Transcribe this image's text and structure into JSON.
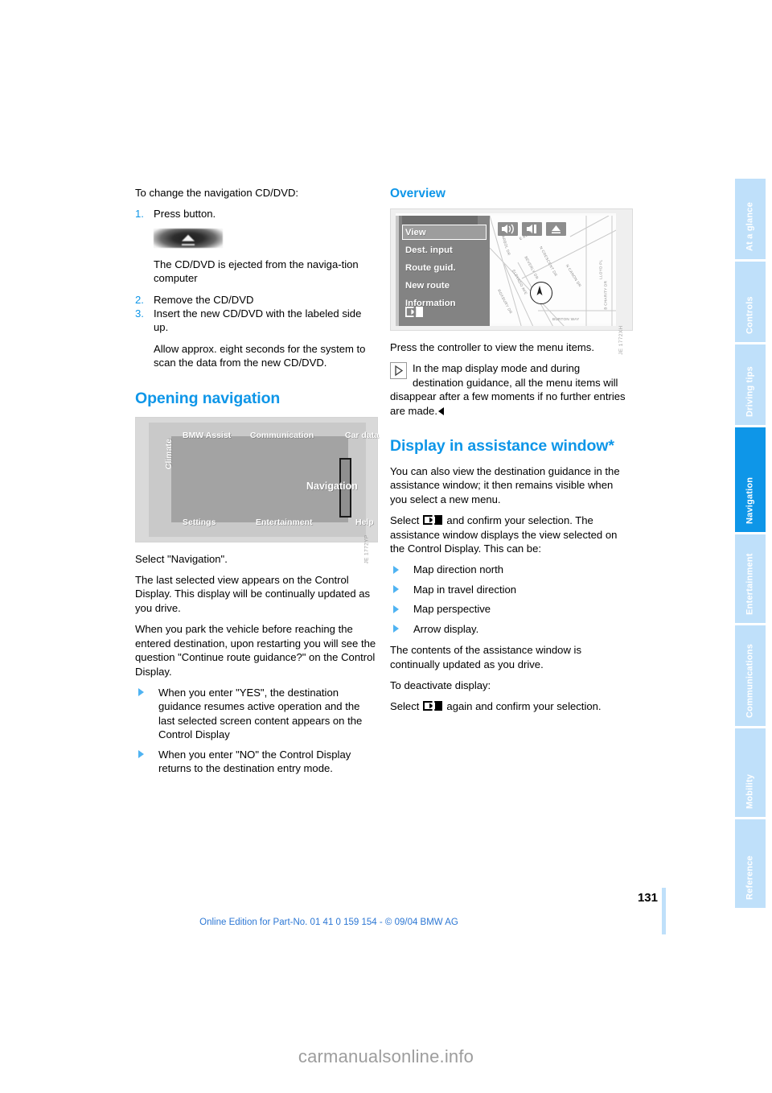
{
  "document": {
    "page_number": "131",
    "footer_text": "Online Edition for Part-No. 01 41 0 159 154 - © 09/04 BMW AG",
    "watermark": "carmanualsonline.info"
  },
  "left_column": {
    "intro": "To change the navigation CD/DVD:",
    "steps": [
      {
        "num": "1.",
        "text": "Press button."
      },
      {
        "num": "2.",
        "text": "Remove the CD/DVD"
      },
      {
        "num": "3.",
        "text": "Insert the new CD/DVD with the labeled side up."
      }
    ],
    "after_step1": "The CD/DVD is ejected from the naviga-tion computer",
    "after_step3": "Allow approx. eight seconds for the system to scan the data from the new CD/DVD.",
    "heading_opening_navigation": "Opening navigation",
    "select_navigation": "Select \"Navigation\".",
    "para_last_view": "The last selected view appears on the Control Display. This display will be continually updated as you drive.",
    "para_park": "When you park the vehicle before reaching the entered destination, upon restarting you will see the question \"Continue route guidance?\" on the Control Display.",
    "bullets": [
      "When you enter \"YES\", the destination guidance resumes active operation and the last selected screen content appears on the Control Display",
      "When you enter \"NO\" the Control Display returns to the destination entry mode."
    ]
  },
  "idrive_figure": {
    "name": "iDrive main menu screen",
    "labels": {
      "top_left": "BMW Assist",
      "top_center": "Communication",
      "top_right": "Car data",
      "left_side": "Climate",
      "center_right": "Navigation",
      "bottom_left": "Settings",
      "bottom_center": "Entertainment",
      "bottom_right": "Help"
    },
    "credit": "JE 1772YP"
  },
  "right_column": {
    "heading_overview": "Overview",
    "press_controller": "Press the controller to view the menu items.",
    "note": "In the map display mode and during destination guidance, all the menu items will disappear after a few moments if no further entries are made.",
    "heading_assistance": "Display in assistance window*",
    "para_assistance": "You can also view the destination guidance in the assistance window; it then remains visible when you select a new menu.",
    "select_prefix": "Select",
    "select_suffix": "and confirm your selection. The assistance window displays the view selected on the Control Display. This can be:",
    "bullets": [
      "Map direction north",
      "Map in travel direction",
      "Map perspective",
      "Arrow display."
    ],
    "para_contents": "The contents of the assistance window is continually updated as you drive.",
    "para_deactivate": "To deactivate display:",
    "deactivate_prefix": "Select",
    "deactivate_suffix": "again and confirm your selection."
  },
  "overview_figure": {
    "name": "Navigation menu on Control Display",
    "menu_items": [
      "View",
      "Dest. input",
      "Route guid.",
      "New route",
      "Information"
    ],
    "selected_item": "View",
    "split_screen_item": "split-screen-icon",
    "map_icons": [
      "speaker-on-icon",
      "speaker-mute-icon",
      "eject-icon"
    ],
    "street_labels": [
      "E BLVD",
      "LLOYD PL",
      "B CHARITY DR",
      "BURTON WAY",
      "N CRESCENT DR",
      "BEVERLY DR",
      "N CANON DR",
      "ELEVADO AVE",
      "ROXBURY DR",
      "N ARBOL DR"
    ],
    "credit": "JE 1772XH"
  },
  "tabs": [
    {
      "label": "At a glance",
      "active": false
    },
    {
      "label": "Controls",
      "active": false
    },
    {
      "label": "Driving tips",
      "active": false
    },
    {
      "label": "Navigation",
      "active": true
    },
    {
      "label": "Entertainment",
      "active": false
    },
    {
      "label": "Communications",
      "active": false
    },
    {
      "label": "Mobility",
      "active": false
    },
    {
      "label": "Reference",
      "active": false
    }
  ],
  "colors": {
    "accent_blue": "#0E96E8",
    "tab_inactive": "#BFE0FA",
    "bullet_blue": "#4FB3F2",
    "footer_blue": "#2C77D4"
  }
}
